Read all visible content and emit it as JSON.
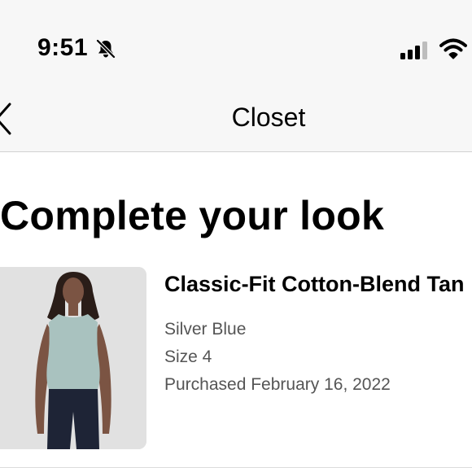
{
  "status_bar": {
    "time": "9:51",
    "icons": [
      "bell-slash-icon",
      "cellular-signal-icon",
      "wifi-icon"
    ]
  },
  "nav": {
    "back_icon": "chevron-left-icon",
    "title": "Closet"
  },
  "section": {
    "heading": "Complete your look"
  },
  "product": {
    "name": "Classic-Fit Cotton-Blend Tan",
    "color": "Silver Blue",
    "size": "Size 4",
    "purchased": "Purchased February 16, 2022",
    "image_icon": "product-photo"
  },
  "colors": {
    "background": "#ffffff",
    "header_background": "#f7f7f7",
    "text_primary": "#000000",
    "text_secondary": "#555555",
    "tank_color": "#a9c2bf",
    "leggings_color": "#1e2436"
  }
}
